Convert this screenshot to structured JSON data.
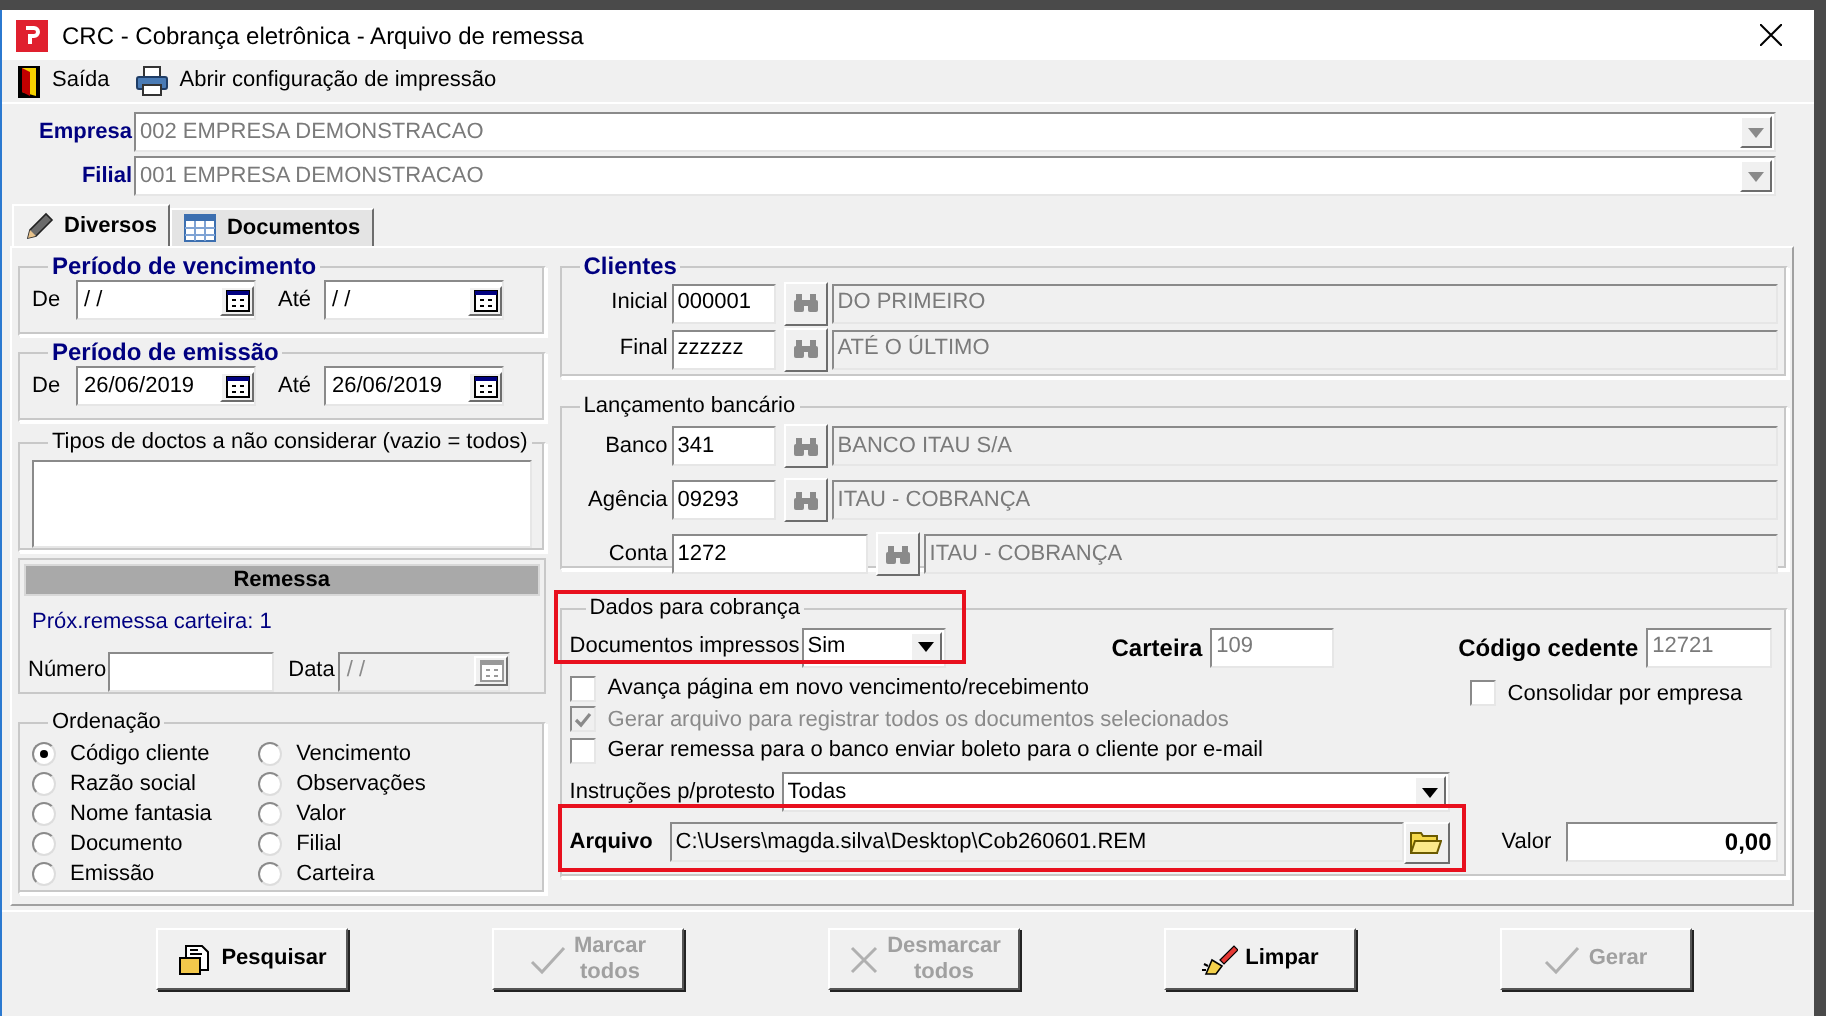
{
  "window": {
    "title": "CRC - Cobrança eletrônica - Arquivo de remessa"
  },
  "toolbar": [
    {
      "label": "Saída",
      "kind": "exit"
    },
    {
      "label": "Abrir configuração de impressão",
      "kind": "print"
    }
  ],
  "selectors": [
    {
      "label": "Empresa",
      "value": "002 EMPRESA DEMONSTRACAO",
      "disabled": true
    },
    {
      "label": "Filial",
      "value": "001 EMPRESA DEMONSTRACAO",
      "disabled": true
    }
  ],
  "tabs": [
    {
      "label": "Diversos",
      "kind": "pencil",
      "selected": true
    },
    {
      "label": "Documentos",
      "kind": "grid",
      "selected": false
    }
  ],
  "periods": [
    {
      "title": "Período de vencimento",
      "from_label": "De",
      "from": "/ /",
      "to_label": "Até",
      "to": "/ /"
    },
    {
      "title": "Período de emissão",
      "from_label": "De",
      "from": "26/06/2019",
      "to_label": "Até",
      "to": "26/06/2019"
    }
  ],
  "doc_types": {
    "title": "Tipos de doctos a não considerar (vazio = todos)"
  },
  "remessa": {
    "title": "Remessa",
    "next": "Próx.remessa carteira: 1",
    "number_label": "Número",
    "date_label": "Data",
    "date": "/ /",
    "date_disabled": true
  },
  "ordering": {
    "title": "Ordenação",
    "options": [
      {
        "label": "Código cliente",
        "selected": true
      },
      {
        "label": "Razão social",
        "selected": false
      },
      {
        "label": "Nome fantasia",
        "selected": false
      },
      {
        "label": "Documento",
        "selected": false
      },
      {
        "label": "Emissão",
        "selected": false
      },
      {
        "label": "Vencimento",
        "selected": false
      },
      {
        "label": "Observações",
        "selected": false
      },
      {
        "label": "Valor",
        "selected": false
      },
      {
        "label": "Filial",
        "selected": false
      },
      {
        "label": "Carteira",
        "selected": false
      }
    ]
  },
  "clients": {
    "title": "Clientes",
    "rows": [
      {
        "label": "Inicial",
        "code": "000001",
        "name": "DO PRIMEIRO",
        "wide": false
      },
      {
        "label": "Final",
        "code": "zzzzzz",
        "name": "ATÉ O ÚLTIMO",
        "wide": false
      }
    ]
  },
  "bank": {
    "title": "Lançamento bancário",
    "rows": [
      {
        "label": "Banco",
        "code": "341",
        "name": "BANCO ITAU S/A",
        "wide": false
      },
      {
        "label": "Agência",
        "code": "09293",
        "name": "ITAU - COBRANÇA",
        "wide": false
      },
      {
        "label": "Conta",
        "code": "1272",
        "name": "ITAU - COBRANÇA",
        "wide": true
      }
    ]
  },
  "billing": {
    "title": "Dados para cobrança",
    "printed_label": "Documentos impressos",
    "printed": "Sim",
    "wallet_label": "Carteira",
    "wallet": "109",
    "cedente_label": "Código cedente",
    "cedente": "12721",
    "options": [
      {
        "label": "Avança página em novo vencimento/recebimento",
        "checked": false,
        "disabled": false
      },
      {
        "label": "Gerar arquivo para registrar todos os documentos selecionados",
        "checked": true,
        "disabled": true
      },
      {
        "label": "Gerar remessa para o banco enviar boleto para o cliente por e-mail",
        "checked": false,
        "disabled": false
      }
    ],
    "consolidate": {
      "label": "Consolidar por empresa",
      "checked": false
    },
    "protest_label": "Instruções p/protesto",
    "protest": "Todas",
    "file_label": "Arquivo",
    "file": "C:\\Users\\magda.silva\\Desktop\\Cob260601.REM",
    "value_label": "Valor",
    "value": "0,00"
  },
  "buttons": [
    {
      "label": "Pesquisar",
      "kind": "search",
      "disabled": false
    },
    {
      "label": "Marcar todos",
      "kind": "check",
      "disabled": true
    },
    {
      "label": "Desmarcar todos",
      "kind": "uncheck",
      "disabled": true
    },
    {
      "label": "Limpar",
      "kind": "clear",
      "disabled": false
    },
    {
      "label": "Gerar",
      "kind": "check",
      "disabled": true
    }
  ]
}
